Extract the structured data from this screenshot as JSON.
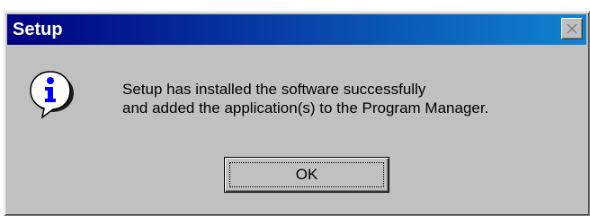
{
  "dialog": {
    "title": "Setup",
    "message_lines": [
      "Setup has installed the software successfully",
      "and added the application(s) to the Program Manager."
    ],
    "ok_label": "OK",
    "icon": "info-icon",
    "close_icon": "close-icon"
  },
  "colors": {
    "titlebar_start": "#000080",
    "titlebar_end": "#1084d0",
    "dialog_bg": "#c0c0c0",
    "icon_blue": "#0000ff"
  }
}
